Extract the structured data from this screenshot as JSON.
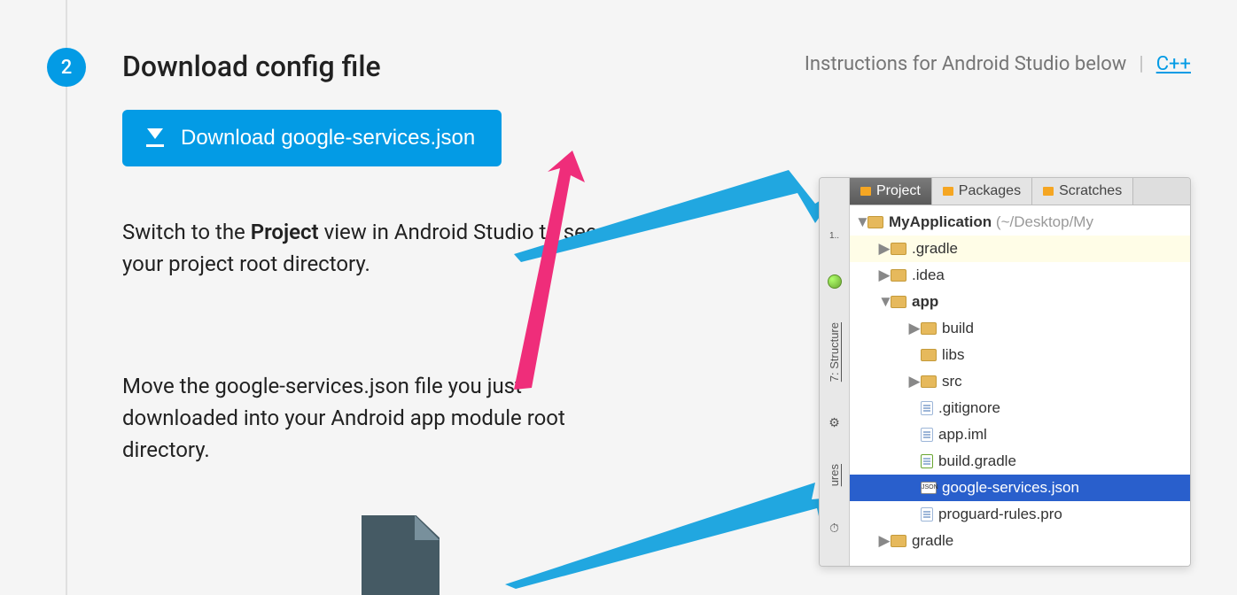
{
  "step": {
    "number": "2",
    "title": "Download config file"
  },
  "header": {
    "instructions_text": "Instructions for Android Studio below",
    "divider": "|",
    "cpp_link": "C++"
  },
  "download_button_label": "Download google-services.json",
  "paragraph1_prefix": "Switch to the ",
  "paragraph1_bold": "Project",
  "paragraph1_suffix": " view in Android Studio to see your project root directory.",
  "paragraph2": "Move the google-services.json file you just downloaded into your Android app module root directory.",
  "ide": {
    "tabs": {
      "project": "Project",
      "packages": "Packages",
      "scratches": "Scratches"
    },
    "sidebar": {
      "structure": "7: Structure",
      "captures": "ures"
    },
    "project_name": "MyApplication",
    "project_path": "(~/Desktop/My",
    "nodes": {
      "gradle_dir": ".gradle",
      "idea_dir": ".idea",
      "app_dir": "app",
      "build": "build",
      "libs": "libs",
      "src": "src",
      "gitignore": ".gitignore",
      "app_iml": "app.iml",
      "build_gradle": "build.gradle",
      "google_services": "google-services.json",
      "proguard": "proguard-rules.pro",
      "gradle_dir2": "gradle"
    }
  }
}
